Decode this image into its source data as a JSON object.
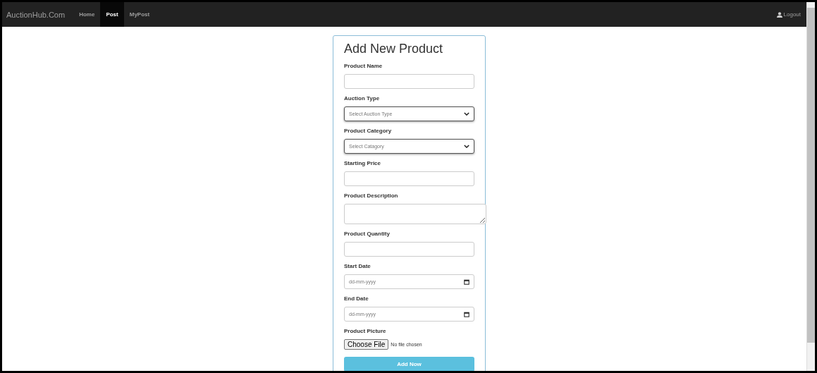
{
  "navbar": {
    "brand": "AuctionHub.Com",
    "links": [
      {
        "label": "Home",
        "selected": false
      },
      {
        "label": "Post",
        "selected": true
      },
      {
        "label": "MyPost",
        "selected": false
      }
    ],
    "logout": "Logout"
  },
  "form": {
    "title": "Add New Product",
    "fields": [
      {
        "kind": "text",
        "label": "Product Name"
      },
      {
        "kind": "select",
        "label": "Auction Type",
        "placeholder": "Select Auction Type"
      },
      {
        "kind": "select",
        "label": "Product Category",
        "placeholder": "Select Catagory"
      },
      {
        "kind": "text",
        "label": "Starting Price"
      },
      {
        "kind": "textarea",
        "label": "Product Description"
      },
      {
        "kind": "text",
        "label": "Product Quantity"
      },
      {
        "kind": "date",
        "label": "Start Date",
        "placeholder": "dd-mm-yyyy"
      },
      {
        "kind": "date",
        "label": "End Date",
        "placeholder": "dd-mm-yyyy"
      },
      {
        "kind": "file",
        "label": "Product Picture",
        "button": "Choose File",
        "status": "No file chosen"
      }
    ],
    "submit": "Add Now"
  }
}
